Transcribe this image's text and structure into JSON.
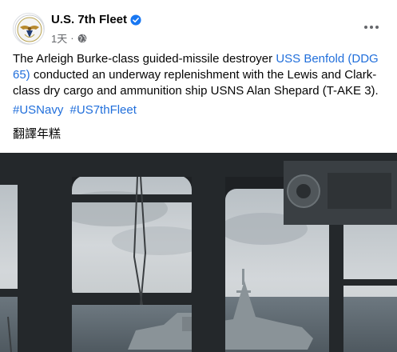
{
  "post": {
    "page_name": "U.S. 7th Fleet",
    "timestamp": "1天",
    "body_prefix": "The Arleigh Burke-class guided-missile destroyer ",
    "body_link": "USS Benfold (DDG 65)",
    "body_suffix": " conducted an underway replenishment with the Lewis and Clark-class dry cargo and ammunition ship USNS Alan Shepard (T-AKE 3).",
    "hashtags": [
      "#USNavy",
      "#US7thFleet"
    ],
    "translate_label": "翻譯年糕"
  },
  "icons": {
    "verified": "verified-badge-icon",
    "privacy": "globe-icon",
    "more": "more-options-icon"
  },
  "colors": {
    "link": "#216fdb",
    "verified": "#1877f2",
    "meta": "#65676b"
  }
}
